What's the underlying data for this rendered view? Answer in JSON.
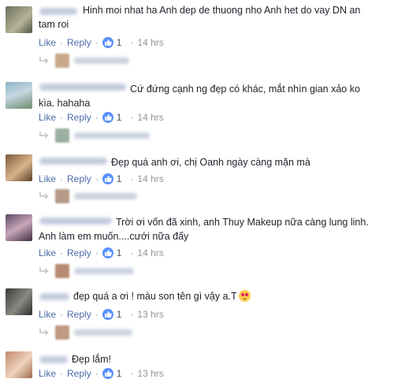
{
  "actions": {
    "like": "Like",
    "reply": "Reply",
    "separator": "·"
  },
  "colors": {
    "link": "#4b6ba8",
    "meta": "#90949c",
    "like_badge": "#5890ff"
  },
  "comments": [
    {
      "text": "Hinh moi nhat ha Anh dep de thuong nho Anh het do vay DN an tam roi",
      "likes": "1",
      "time": "14 hrs"
    },
    {
      "text": "Cứ đứng cạnh ng đẹp có khác, mắt nhìn gian xảo ko kìa. hahaha",
      "likes": "1",
      "time": "14 hrs"
    },
    {
      "text": "Đẹp quá anh ơi, chị Oanh ngày càng mặn mà",
      "likes": "1",
      "time": "14 hrs"
    },
    {
      "text": "Trời ơi vốn đã xinh, anh Thuy Makeup nữa càng lung linh. Anh làm em muốn....cưới nữa đấy",
      "likes": "1",
      "time": "14 hrs"
    },
    {
      "text": "đẹp quá a ơi ! màu son tên gì vậy a.T",
      "likes": "1",
      "time": "13 hrs"
    },
    {
      "text": "Đẹp lắm!",
      "likes": "1",
      "time": "13 hrs"
    }
  ],
  "icons": {
    "like_badge": "thumbs-up-icon",
    "reply_arrow": "reply-arrow-icon",
    "emoji": "smiling-face-icon"
  }
}
